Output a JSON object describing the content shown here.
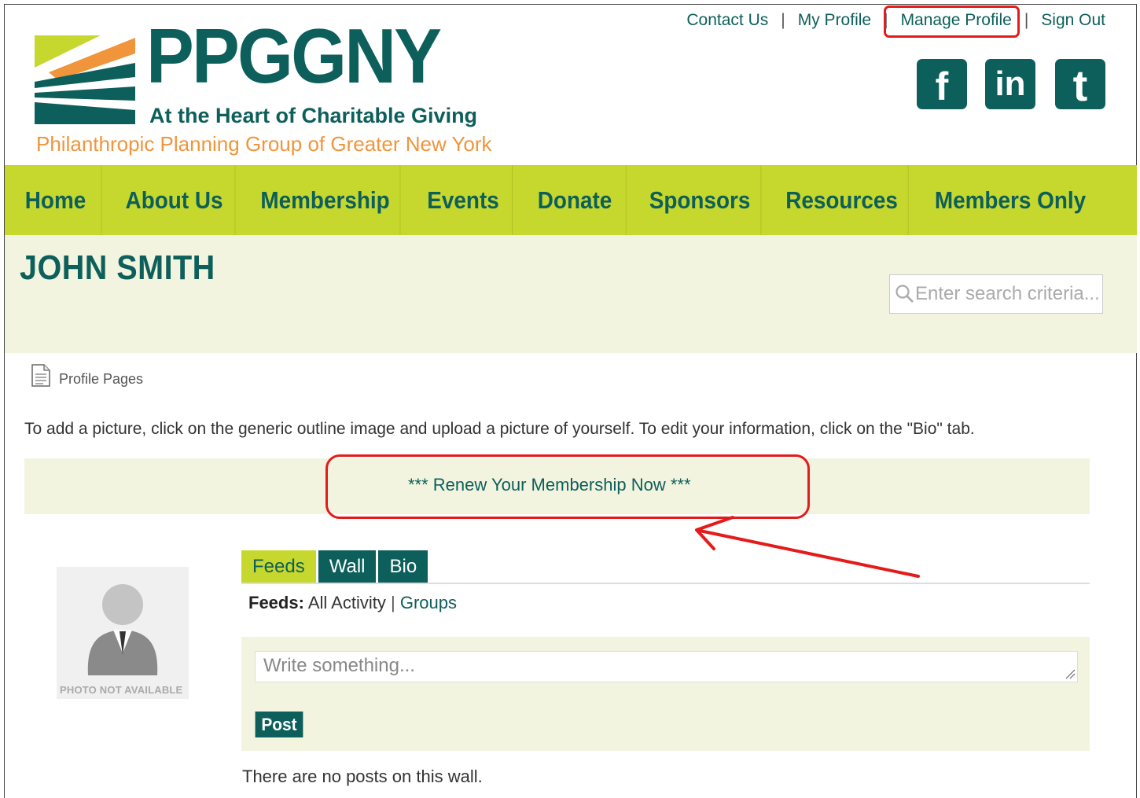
{
  "header": {
    "logo": {
      "wordmark": "PPGGNY",
      "tagline": "At the Heart of Charitable Giving",
      "subtitle": "Philanthropic Planning Group of Greater New York"
    },
    "top_links": [
      "Contact Us",
      "My Profile",
      "Manage Profile",
      "Sign Out"
    ],
    "social": [
      {
        "name": "facebook",
        "glyph": "f"
      },
      {
        "name": "linkedin",
        "glyph": "in"
      },
      {
        "name": "twitter",
        "glyph": "t"
      }
    ]
  },
  "nav": {
    "items": [
      "Home",
      "About Us",
      "Membership",
      "Events",
      "Donate",
      "Sponsors",
      "Resources",
      "Members Only"
    ]
  },
  "page": {
    "title": "JOHN SMITH",
    "search_placeholder": "Enter search criteria..."
  },
  "profile": {
    "pages_label": "Profile Pages",
    "intro": "To add a picture, click on the generic outline image and upload a picture of yourself. To edit your information, click on the \"Bio\" tab.",
    "renew": "*** Renew Your Membership Now ***",
    "avatar_caption": "PHOTO NOT AVAILABLE",
    "tabs": [
      "Feeds",
      "Wall",
      "Bio"
    ],
    "active_tab": "Feeds",
    "feeds": {
      "label": "Feeds:",
      "all": "All Activity",
      "sep": "|",
      "groups": "Groups"
    },
    "post_placeholder": "Write something...",
    "post_button": "Post",
    "empty_message": "There are no posts on this wall."
  },
  "colors": {
    "brand_teal": "#0d5f5b",
    "nav_green": "#c6d82d",
    "band": "#f2f4df",
    "accent_orange": "#f0953b",
    "annotation_red": "#e41b1b"
  }
}
